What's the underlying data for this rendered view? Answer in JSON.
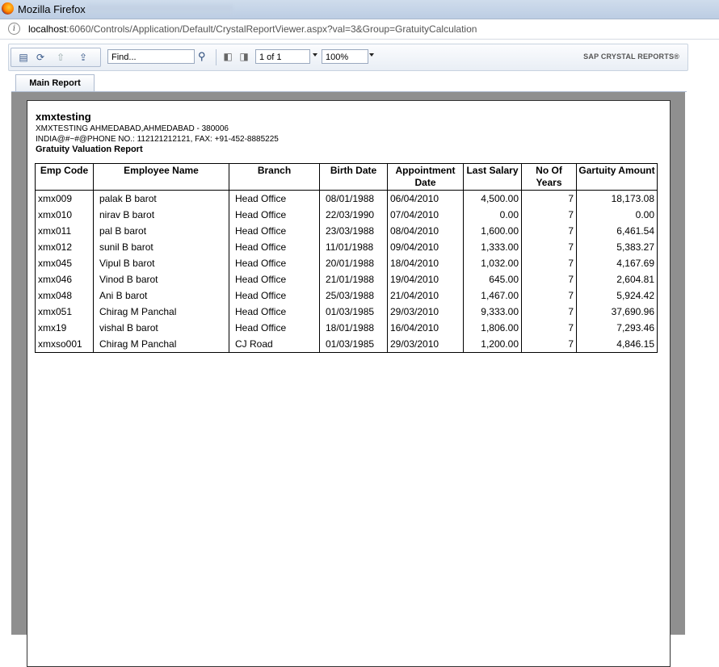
{
  "window": {
    "title": "Mozilla Firefox"
  },
  "address": {
    "host": "localhost",
    "rest": ":6060/Controls/Application/Default/CrystalReportViewer.aspx?val=3&Group=GratuityCalculation"
  },
  "toolbar": {
    "find_placeholder": "Find...",
    "page_value": "1 of 1",
    "zoom_value": "100%",
    "brand": "SAP CRYSTAL REPORTS®"
  },
  "tabs": [
    {
      "label": "Main Report"
    }
  ],
  "report": {
    "company": "xmxtesting",
    "address_line1": "XMXTESTING AHMEDABAD,AHMEDABAD - 380006",
    "address_line2": "INDIA@#~#@PHONE NO.:  112121212121, FAX:  +91-452-8885225",
    "title": "Gratuity Valuation Report",
    "columns": [
      "Emp Code",
      "Employee Name",
      "Branch",
      "Birth Date",
      "Appointment Date",
      "Last Salary",
      "No Of Years",
      "Gartuity Amount"
    ],
    "rows": [
      [
        "xmx009",
        "palak B barot",
        "Head Office",
        "08/01/1988",
        "06/04/2010",
        "4,500.00",
        "7",
        "18,173.08"
      ],
      [
        "xmx010",
        "nirav B barot",
        "Head Office",
        "22/03/1990",
        "07/04/2010",
        "0.00",
        "7",
        "0.00"
      ],
      [
        "xmx011",
        "pal B barot",
        "Head Office",
        "23/03/1988",
        "08/04/2010",
        "1,600.00",
        "7",
        "6,461.54"
      ],
      [
        "xmx012",
        "sunil B barot",
        "Head Office",
        "11/01/1988",
        "09/04/2010",
        "1,333.00",
        "7",
        "5,383.27"
      ],
      [
        "xmx045",
        "Vipul B barot",
        "Head Office",
        "20/01/1988",
        "18/04/2010",
        "1,032.00",
        "7",
        "4,167.69"
      ],
      [
        "xmx046",
        "Vinod B barot",
        "Head Office",
        "21/01/1988",
        "19/04/2010",
        "645.00",
        "7",
        "2,604.81"
      ],
      [
        "xmx048",
        "Ani B barot",
        "Head Office",
        "25/03/1988",
        "21/04/2010",
        "1,467.00",
        "7",
        "5,924.42"
      ],
      [
        "xmx051",
        "Chirag M Panchal",
        "Head Office",
        "01/03/1985",
        "29/03/2010",
        "9,333.00",
        "7",
        "37,690.96"
      ],
      [
        "xmx19",
        "vishal B barot",
        "Head Office",
        "18/01/1988",
        "16/04/2010",
        "1,806.00",
        "7",
        "7,293.46"
      ],
      [
        "xmxso001",
        "Chirag M Panchal",
        "CJ Road",
        "01/03/1985",
        "29/03/2010",
        "1,200.00",
        "7",
        "4,846.15"
      ]
    ]
  }
}
